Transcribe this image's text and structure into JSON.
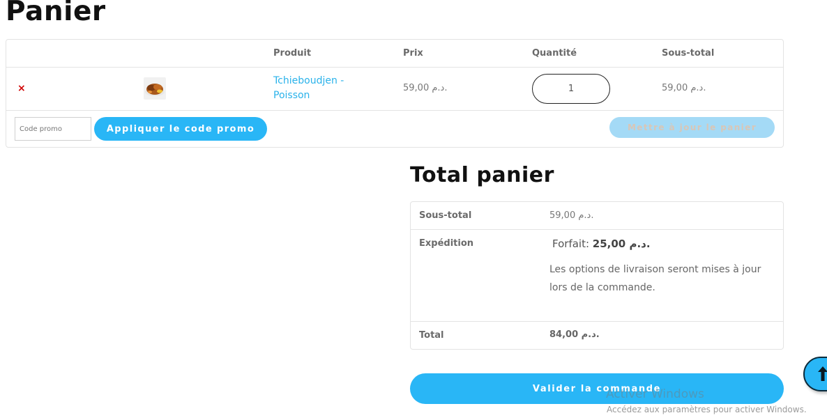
{
  "page": {
    "title": "Panier"
  },
  "cart": {
    "headers": {
      "product": "Produit",
      "price": "Prix",
      "quantity": "Quantité",
      "subtotal": "Sous-total"
    },
    "items": [
      {
        "remove_icon": "×",
        "product_name": "Tchieboudjen - Poisson",
        "price": "59,00 د.م.",
        "quantity": "1",
        "subtotal": "59,00 د.م."
      }
    ],
    "coupon": {
      "placeholder": "Code promo",
      "value": "",
      "apply_label": "Appliquer le code promo"
    },
    "update_label": "Mettre à jour le panier"
  },
  "totals": {
    "title": "Total panier",
    "subtotal_label": "Sous-total",
    "subtotal_value": "59,00 د.م.",
    "shipping_label": "Expédition",
    "shipping_rate_label": "Forfait:",
    "shipping_rate_value": "25,00 د.م.",
    "shipping_note": "Les options de livraison seront mises à jour lors de la commande.",
    "total_label": "Total",
    "total_value": "84,00 د.م."
  },
  "checkout_label": "Valider la commande",
  "scroll_top_icon": "arrow-up-icon",
  "os_watermark": {
    "title": "Activer Windows",
    "subtitle": "Accédez aux paramètres pour activer Windows."
  },
  "colors": {
    "accent": "#29b6f6",
    "link": "#29b2ea",
    "remove": "#d00000",
    "update_button": "#a4daf6"
  }
}
